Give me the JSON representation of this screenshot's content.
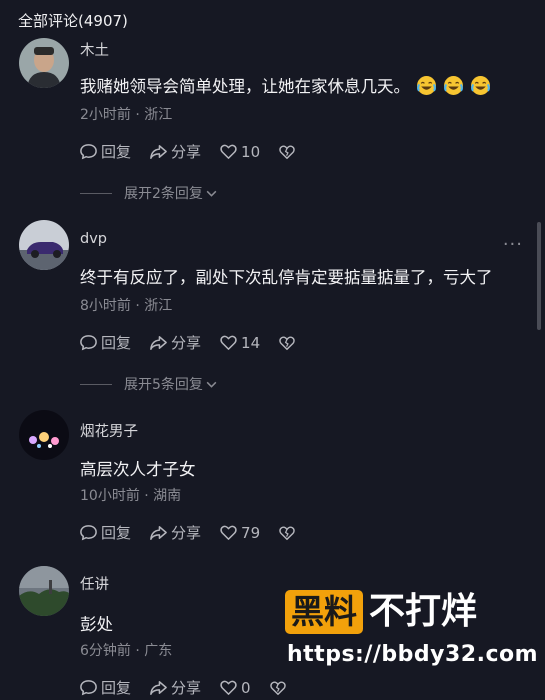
{
  "header": {
    "title": "全部评论(4907)"
  },
  "comments": [
    {
      "username": "木土",
      "text": "我赌她领导会简单处理，让她在家休息几天。",
      "emojis": [
        "laugh-cry-emoji",
        "laugh-cry-emoji",
        "laugh-cry-emoji"
      ],
      "meta": "2小时前 · 浙江",
      "reply_label": "回复",
      "share_label": "分享",
      "likes": "10",
      "expand_label": "展开2条回复"
    },
    {
      "username": "dvp",
      "text": "终于有反应了，副处下次乱停肯定要掂量掂量了，亏大了",
      "meta": "8小时前 · 浙江",
      "reply_label": "回复",
      "share_label": "分享",
      "likes": "14",
      "expand_label": "展开5条回复",
      "more": "···"
    },
    {
      "username": "烟花男子",
      "text": "高层次人才子女",
      "meta": "10小时前 · 湖南",
      "reply_label": "回复",
      "share_label": "分享",
      "likes": "79"
    },
    {
      "username": "任讲",
      "text": "彭处",
      "meta": "6分钟前 · 广东",
      "reply_label": "回复",
      "share_label": "分享",
      "likes": "0"
    }
  ],
  "watermark": {
    "badge": "黑料",
    "title": "不打烊",
    "url": "https://bbdy32.com"
  },
  "colors": {
    "background": "#161823",
    "badge": "#f2a10b"
  }
}
